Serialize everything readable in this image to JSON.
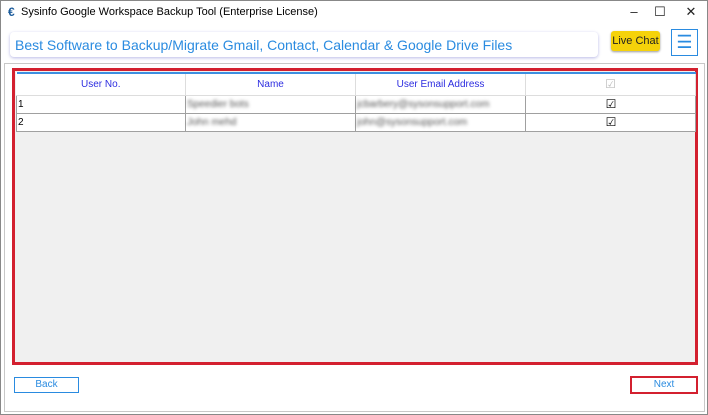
{
  "window": {
    "title": "Sysinfo Google Workspace Backup Tool (Enterprise License)",
    "minimize": "–",
    "maximize": "☐",
    "close": "✕"
  },
  "header": {
    "banner": "Best Software to Backup/Migrate Gmail, Contact, Calendar & Google Drive Files",
    "live_chat": "Live Chat",
    "menu_icon": "☰"
  },
  "table": {
    "columns": [
      "User No.",
      "Name",
      "User Email Address",
      "☑"
    ],
    "rows": [
      {
        "no": "1",
        "name": "Speedier bots",
        "email": "jcbarbery@sysonsupport.com",
        "checked": "☑"
      },
      {
        "no": "2",
        "name": "John mehd",
        "email": "john@sysonsupport.com",
        "checked": "☑"
      }
    ]
  },
  "footer": {
    "back": "Back",
    "next": "Next"
  }
}
